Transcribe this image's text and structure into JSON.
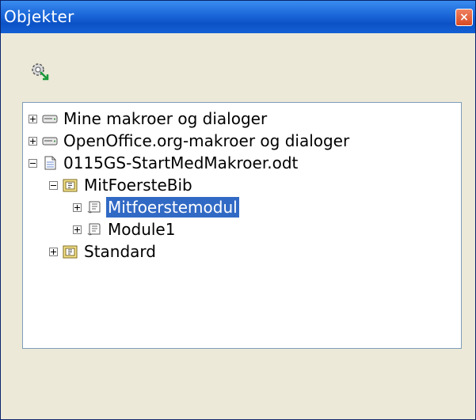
{
  "window": {
    "title": "Objekter",
    "close_symbol": "×",
    "toolbar_icon": "gear-link-icon"
  },
  "tree": {
    "items": [
      {
        "label": "Mine makroer og dialoger",
        "icon": "drive-icon",
        "expander": "plus",
        "level": 0
      },
      {
        "label": "OpenOffice.org-makroer og dialoger",
        "icon": "drive-icon",
        "expander": "plus",
        "level": 0
      },
      {
        "label": "0115GS-StartMedMakroer.odt",
        "icon": "document-icon",
        "expander": "minus",
        "level": 0
      },
      {
        "label": "MitFoersteBib",
        "icon": "library-icon",
        "expander": "minus",
        "level": 1
      },
      {
        "label": "Mitfoerstemodul",
        "icon": "module-icon",
        "expander": "plus",
        "level": 2,
        "selected": true
      },
      {
        "label": "Module1",
        "icon": "module-icon",
        "expander": "plus",
        "level": 2
      },
      {
        "label": "Standard",
        "icon": "library-icon",
        "expander": "plus",
        "level": 1
      }
    ]
  },
  "colors": {
    "selection": "#316ac5",
    "titlebar": "#0b52c6",
    "dialog_bg": "#ece9d8"
  }
}
